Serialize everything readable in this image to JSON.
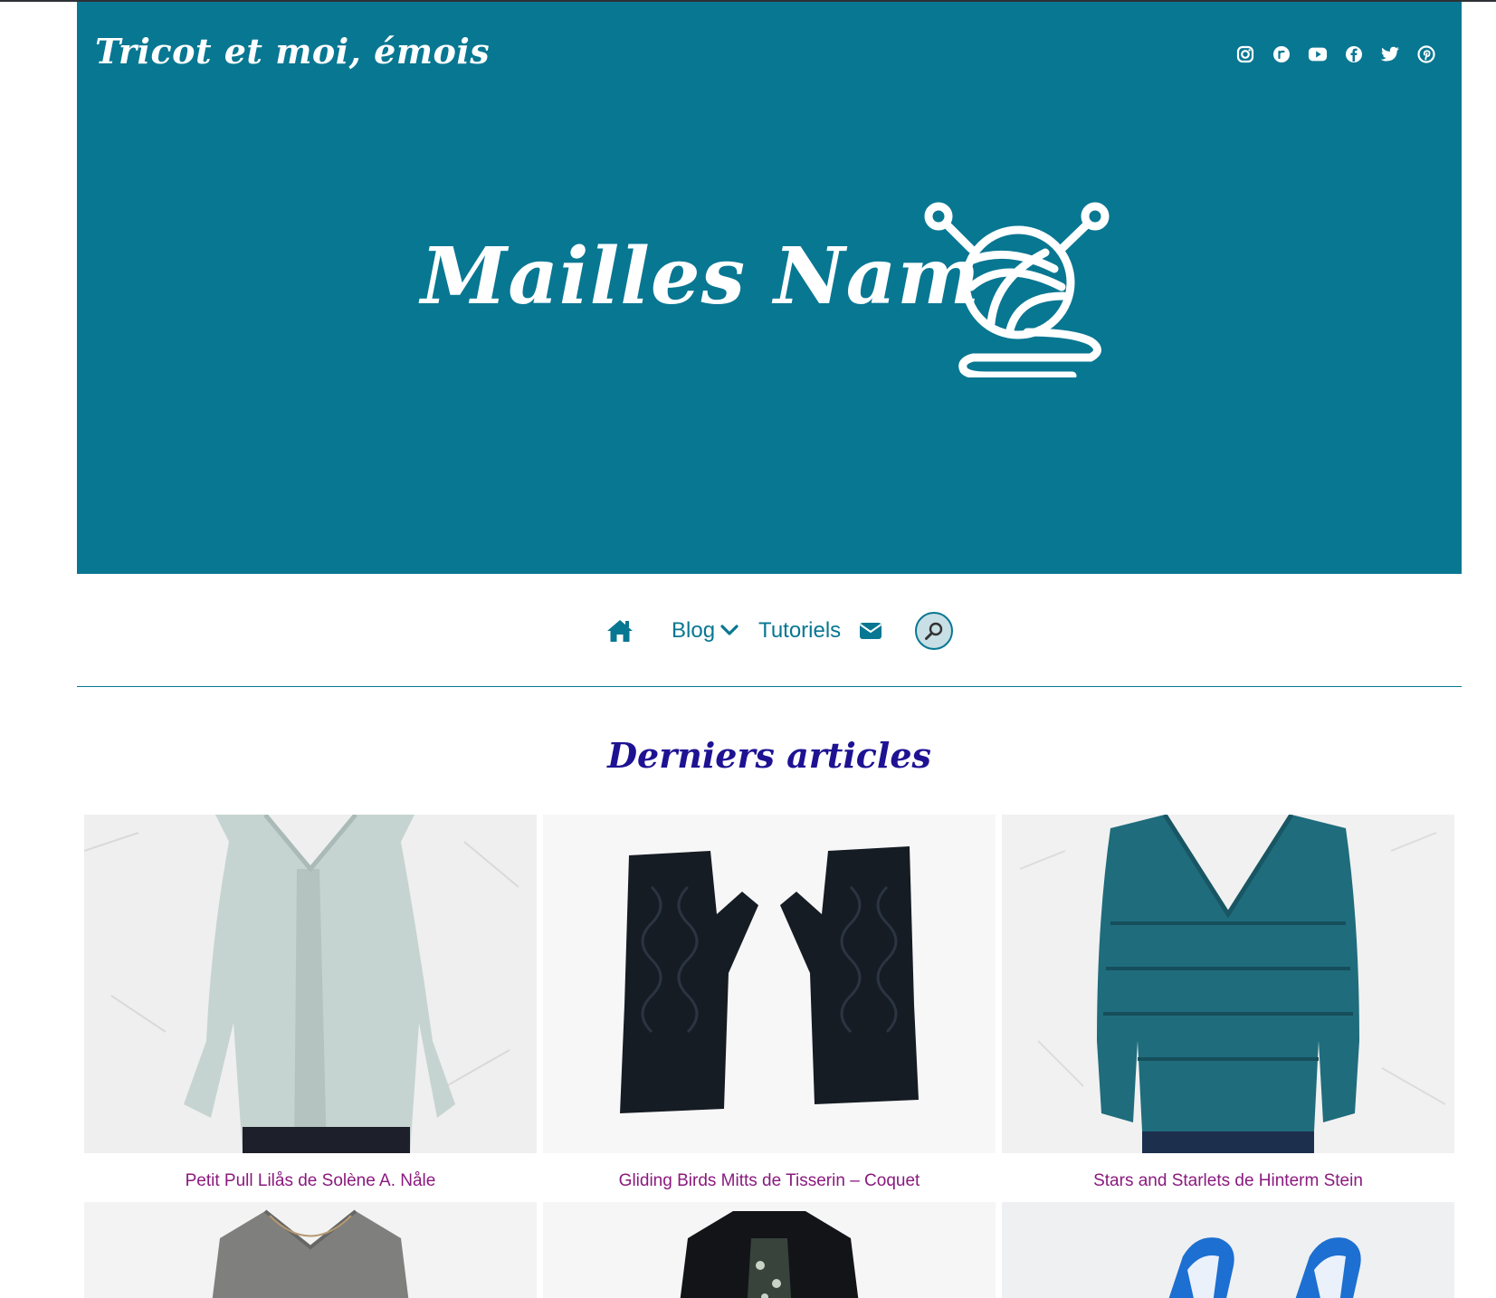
{
  "header": {
    "site_title": "Tricot et moi, émois",
    "logo_text": "Mailles Nam",
    "background_color": "#087792",
    "social_icons": [
      "instagram-icon",
      "ravelry-icon",
      "youtube-icon",
      "facebook-icon",
      "twitter-icon",
      "pinterest-icon"
    ]
  },
  "nav": {
    "home_icon": "home-icon",
    "items": [
      {
        "label": "Blog",
        "has_dropdown": true
      },
      {
        "label": "Tutoriels",
        "has_dropdown": false
      }
    ],
    "mail_icon": "envelope-icon",
    "search_icon": "search-icon",
    "link_color": "#087792"
  },
  "main": {
    "section_title": "Derniers articles",
    "section_title_color": "#1e1293",
    "caption_color": "#8a1a7e",
    "posts": [
      {
        "title": "Petit Pull Lilås de Solène A. Nåle",
        "image": "light-mint-sweater-photo"
      },
      {
        "title": "Gliding Birds Mitts de Tisserin – Coquet",
        "image": "navy-fingerless-mitts-photo"
      },
      {
        "title": "Stars and Starlets de Hinterm Stein",
        "image": "teal-v-neck-sweater-photo"
      },
      {
        "title": "",
        "image": "grey-v-neck-sweater-photo"
      },
      {
        "title": "",
        "image": "black-cardigan-photo"
      },
      {
        "title": "",
        "image": "blue-yarn-clips-photo"
      }
    ]
  }
}
